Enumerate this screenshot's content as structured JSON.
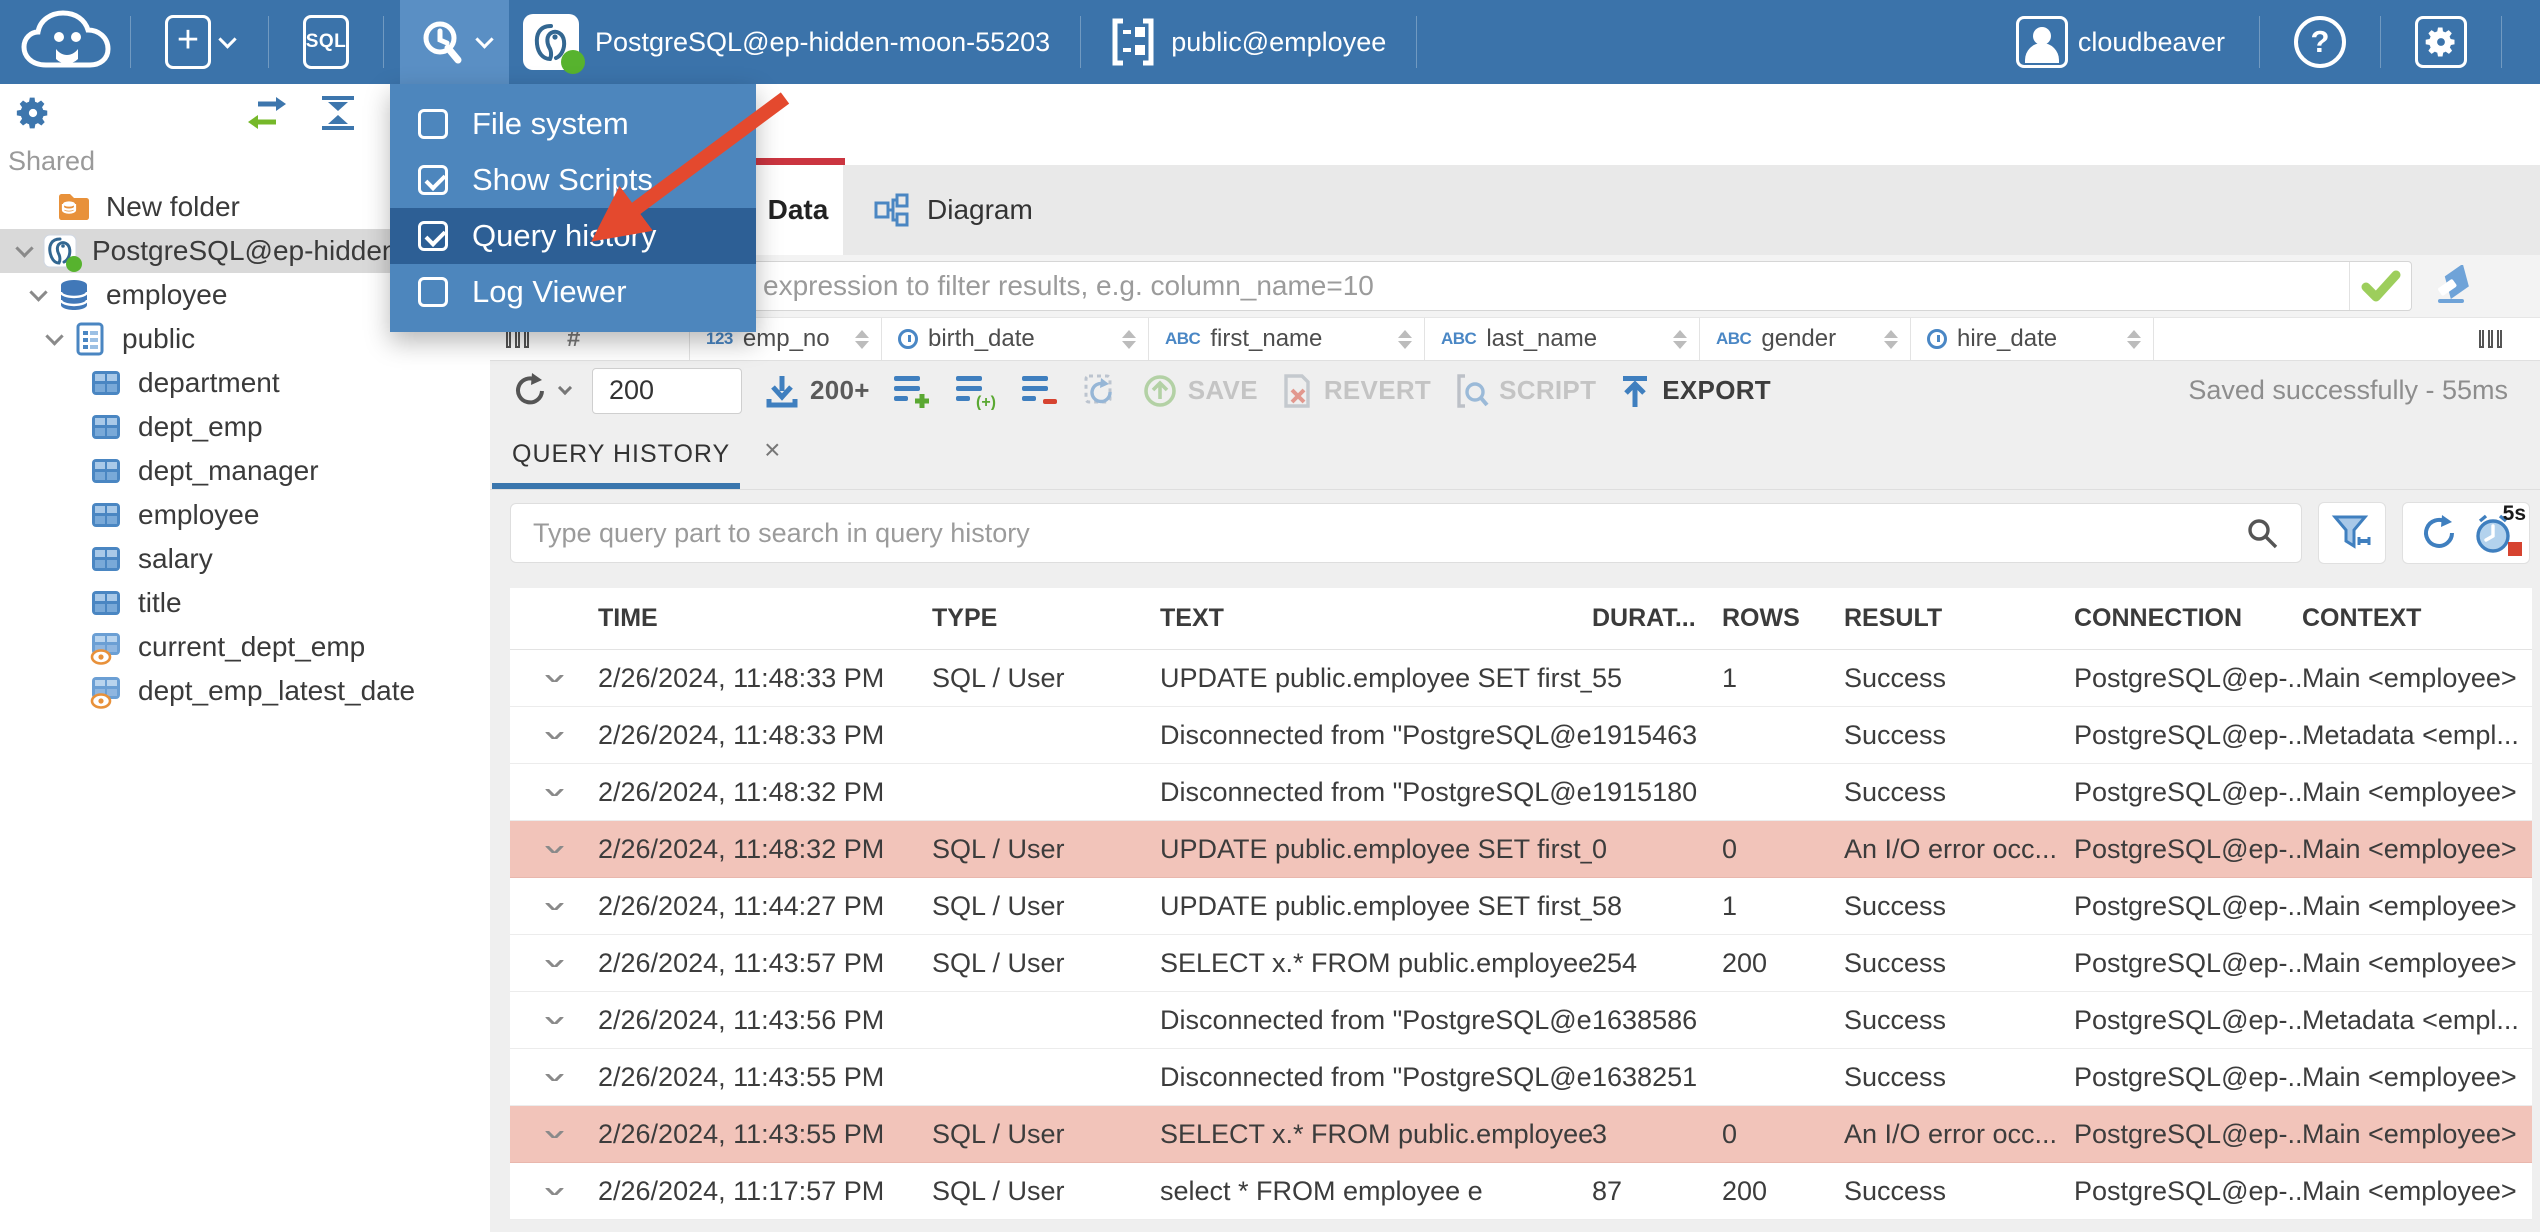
{
  "topbar": {
    "sql_label": "SQL",
    "connection": "PostgreSQL@ep-hidden-moon-55203",
    "schema": "public@employee",
    "user": "cloudbeaver",
    "help_label": "?"
  },
  "tools_menu": {
    "items": [
      {
        "label": "File system",
        "checked": false,
        "selected": false
      },
      {
        "label": "Show Scripts",
        "checked": true,
        "selected": false
      },
      {
        "label": "Query history",
        "checked": true,
        "selected": true
      },
      {
        "label": "Log Viewer",
        "checked": false,
        "selected": false
      }
    ]
  },
  "sidebar": {
    "section": "Shared",
    "tree": [
      {
        "label": "New folder",
        "icon": "folder-database",
        "level": 1
      },
      {
        "label": "PostgreSQL@ep-hidden-",
        "icon": "postgresql",
        "level": 0,
        "selected": true,
        "expanded": true
      },
      {
        "label": "employee",
        "icon": "database",
        "level": 1,
        "expanded": true
      },
      {
        "label": "public",
        "icon": "schema",
        "level": 2,
        "expanded": true
      },
      {
        "label": "department",
        "icon": "table",
        "level": 3
      },
      {
        "label": "dept_emp",
        "icon": "table",
        "level": 3
      },
      {
        "label": "dept_manager",
        "icon": "table",
        "level": 3
      },
      {
        "label": "employee",
        "icon": "table",
        "level": 3
      },
      {
        "label": "salary",
        "icon": "table",
        "level": 3
      },
      {
        "label": "title",
        "icon": "table",
        "level": 3
      },
      {
        "label": "current_dept_emp",
        "icon": "view",
        "level": 3
      },
      {
        "label": "dept_emp_latest_date",
        "icon": "view",
        "level": 3
      }
    ]
  },
  "main": {
    "tabs": [
      {
        "label": "Data"
      },
      {
        "label": "Diagram"
      }
    ],
    "filter_placeholder": "expression to filter results, e.g. column_name=10",
    "grid_columns": [
      "emp_no",
      "birth_date",
      "first_name",
      "last_name",
      "gender",
      "hire_date"
    ],
    "row_number_header": "#",
    "toolbar": {
      "row_limit": "200",
      "fetch_more": "200+",
      "save": "SAVE",
      "revert": "REVERT",
      "script": "SCRIPT",
      "export": "EXPORT",
      "status": "Saved successfully - 55ms"
    }
  },
  "query_history": {
    "tab_label": "QUERY HISTORY",
    "close_label": "×",
    "search_placeholder": "Type query part to search in query history",
    "refresh_interval": "5s",
    "columns": [
      "TIME",
      "TYPE",
      "TEXT",
      "DURAT...",
      "ROWS",
      "RESULT",
      "CONNECTION",
      "CONTEXT"
    ],
    "rows": [
      {
        "time": "2/26/2024, 11:48:33 PM",
        "type": "SQL / User",
        "text": "UPDATE public.employee SET first_...",
        "duration": "55",
        "rows": "1",
        "result": "Success",
        "connection": "PostgreSQL@ep-...",
        "context": "Main <employee>",
        "error": false
      },
      {
        "time": "2/26/2024, 11:48:33 PM",
        "type": "",
        "text": "Disconnected from \"PostgreSQL@e...",
        "duration": "1915463",
        "rows": "",
        "result": "Success",
        "connection": "PostgreSQL@ep-...",
        "context": "Metadata <empl...",
        "error": false
      },
      {
        "time": "2/26/2024, 11:48:32 PM",
        "type": "",
        "text": "Disconnected from \"PostgreSQL@e...",
        "duration": "1915180",
        "rows": "",
        "result": "Success",
        "connection": "PostgreSQL@ep-...",
        "context": "Main <employee>",
        "error": false
      },
      {
        "time": "2/26/2024, 11:48:32 PM",
        "type": "SQL / User",
        "text": "UPDATE public.employee SET first_...",
        "duration": "0",
        "rows": "0",
        "result": "An I/O error occ...",
        "connection": "PostgreSQL@ep-...",
        "context": "Main <employee>",
        "error": true
      },
      {
        "time": "2/26/2024, 11:44:27 PM",
        "type": "SQL / User",
        "text": "UPDATE public.employee SET first_...",
        "duration": "58",
        "rows": "1",
        "result": "Success",
        "connection": "PostgreSQL@ep-...",
        "context": "Main <employee>",
        "error": false
      },
      {
        "time": "2/26/2024, 11:43:57 PM",
        "type": "SQL / User",
        "text": "SELECT x.* FROM public.employee x",
        "duration": "254",
        "rows": "200",
        "result": "Success",
        "connection": "PostgreSQL@ep-...",
        "context": "Main <employee>",
        "error": false
      },
      {
        "time": "2/26/2024, 11:43:56 PM",
        "type": "",
        "text": "Disconnected from \"PostgreSQL@e...",
        "duration": "1638586",
        "rows": "",
        "result": "Success",
        "connection": "PostgreSQL@ep-...",
        "context": "Metadata <empl...",
        "error": false
      },
      {
        "time": "2/26/2024, 11:43:55 PM",
        "type": "",
        "text": "Disconnected from \"PostgreSQL@e...",
        "duration": "1638251",
        "rows": "",
        "result": "Success",
        "connection": "PostgreSQL@ep-...",
        "context": "Main <employee>",
        "error": false
      },
      {
        "time": "2/26/2024, 11:43:55 PM",
        "type": "SQL / User",
        "text": "SELECT x.* FROM public.employee x",
        "duration": "3",
        "rows": "0",
        "result": "An I/O error occ...",
        "connection": "PostgreSQL@ep-...",
        "context": "Main <employee>",
        "error": true
      },
      {
        "time": "2/26/2024, 11:17:57 PM",
        "type": "SQL / User",
        "text": "select * FROM employee e",
        "duration": "87",
        "rows": "200",
        "result": "Success",
        "connection": "PostgreSQL@ep-...",
        "context": "Main <employee>",
        "error": false
      }
    ]
  }
}
